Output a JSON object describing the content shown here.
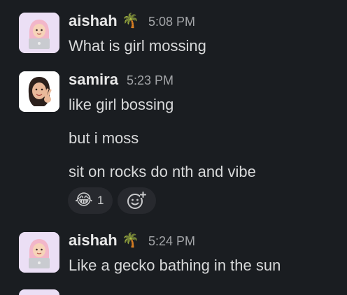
{
  "messages": [
    {
      "author": "aishah",
      "status_emoji": "🌴",
      "time": "5:08 PM",
      "lines": [
        "What is girl mossing"
      ]
    },
    {
      "author": "samira",
      "time": "5:23 PM",
      "lines": [
        "like girl bossing",
        "but i moss",
        "sit on rocks do nth and vibe"
      ],
      "reactions": [
        {
          "emoji": "😂",
          "count": "1"
        }
      ]
    },
    {
      "author": "aishah",
      "status_emoji": "🌴",
      "time": "5:24 PM",
      "lines": [
        "Like a gecko bathing in the sun"
      ]
    }
  ],
  "icons": {
    "add_reaction": "add-reaction-icon",
    "avatar_aishah": "memoji-hijab-laptop-icon",
    "avatar_samira": "memoji-peace-sign-icon"
  },
  "colors": {
    "background": "#1a1d21",
    "reaction_pill": "#27292e",
    "avatar_bg": "#e8ddf3"
  }
}
